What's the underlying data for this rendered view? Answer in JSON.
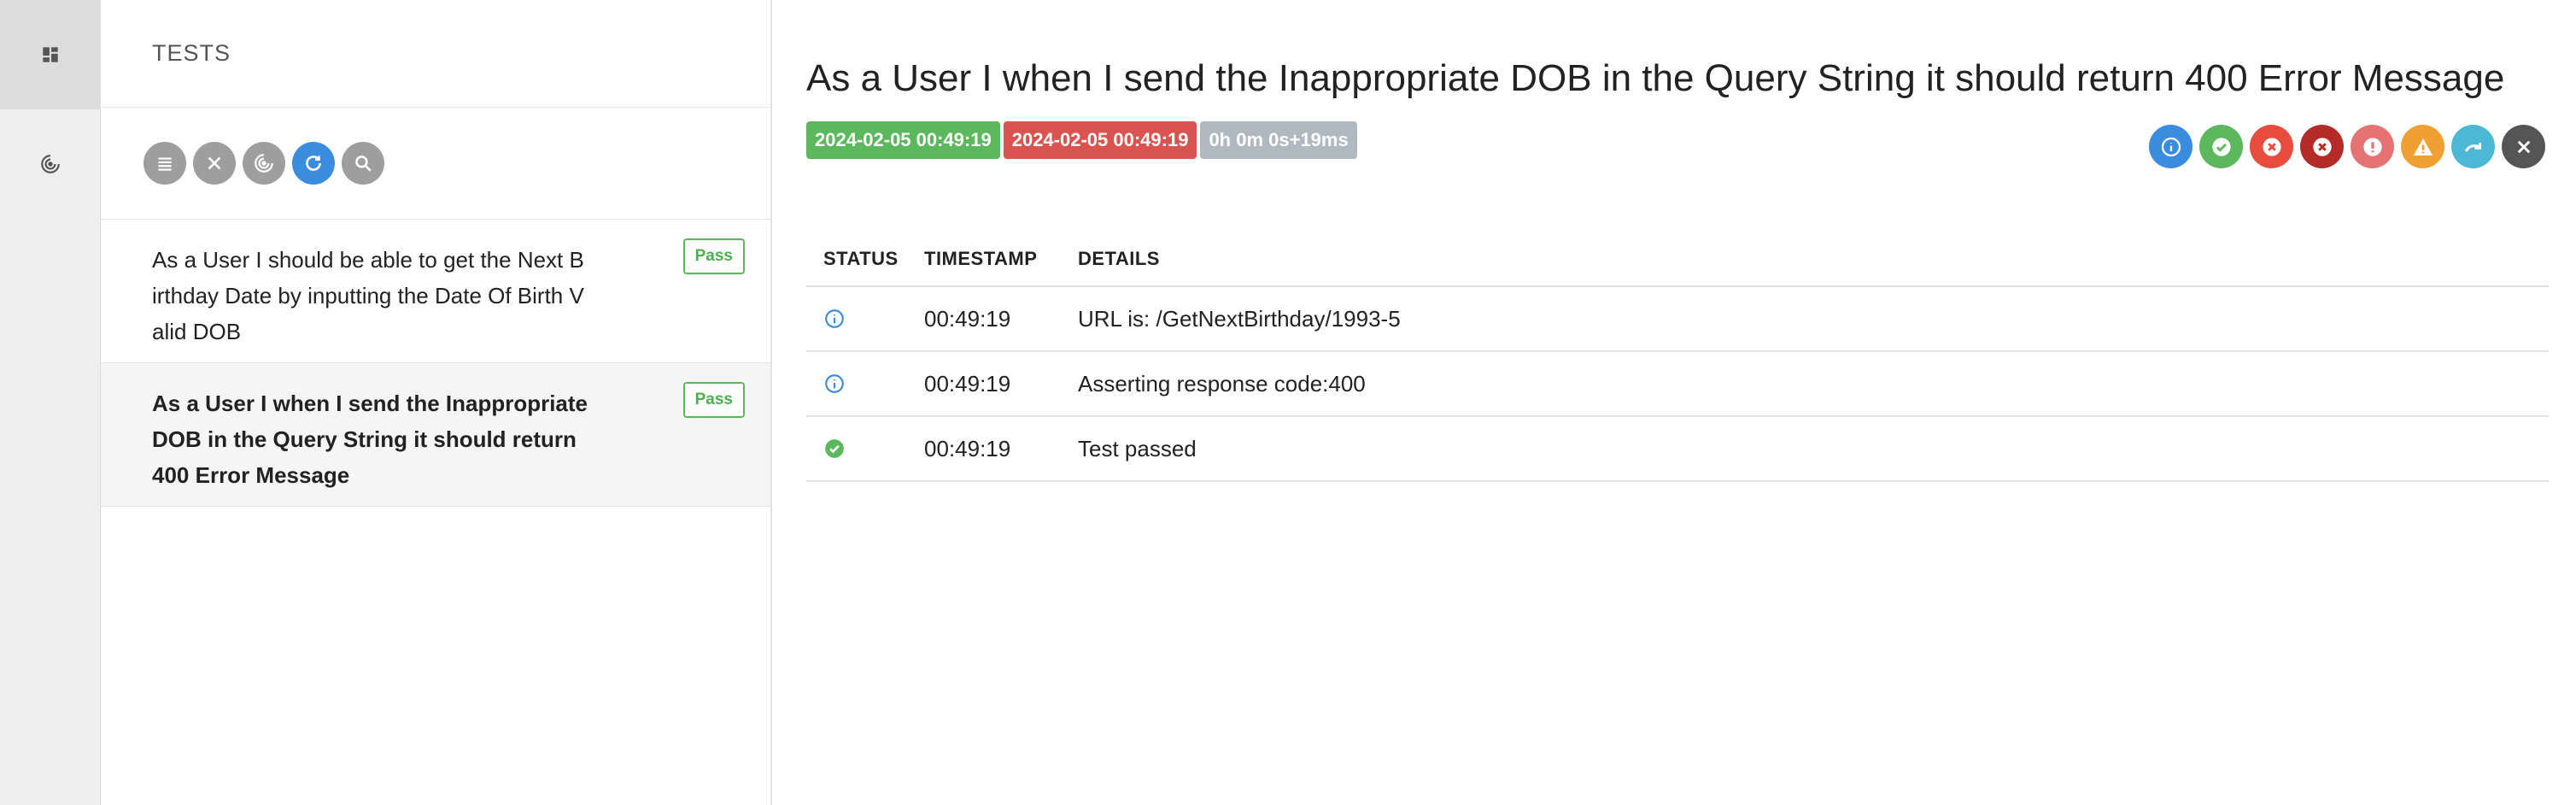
{
  "sidebar": {
    "items": [
      {
        "icon": "dashboard-icon",
        "active": true
      },
      {
        "icon": "radar-icon",
        "active": false
      }
    ]
  },
  "list": {
    "header": "TESTS",
    "toolbar": [
      "menu-icon",
      "close-icon",
      "radar-icon",
      "refresh-icon",
      "search-icon"
    ],
    "tests": [
      {
        "name": "As a User I should be able to get the Next Birthday Date by inputting the Date Of Birth Valid DOB",
        "status": "Pass"
      },
      {
        "name": "As a User I when I send the Inappropriate DOB in the Query String it should return 400 Error Message",
        "status": "Pass"
      }
    ]
  },
  "detail": {
    "title": "As a User I when I send the Inappropriate DOB in the Query String it should return 400 Error Message",
    "start_time": "2024-02-05 00:49:19",
    "end_time": "2024-02-05 00:49:19",
    "duration": "0h 0m 0s+19ms",
    "filters": [
      {
        "name": "info-filter-icon",
        "color": "#3a8dde"
      },
      {
        "name": "pass-filter-icon",
        "color": "#5cb85c"
      },
      {
        "name": "fail-filter-icon",
        "color": "#e74c3c"
      },
      {
        "name": "fatal-filter-icon",
        "color": "#b52b27"
      },
      {
        "name": "error-filter-icon",
        "color": "#e57373"
      },
      {
        "name": "warning-filter-icon",
        "color": "#f0a030"
      },
      {
        "name": "skip-filter-icon",
        "color": "#4cb8d6"
      },
      {
        "name": "clear-filter-icon",
        "color": "#555555"
      }
    ],
    "table": {
      "headers": [
        "STATUS",
        "TIMESTAMP",
        "DETAILS"
      ],
      "rows": [
        {
          "status": "info",
          "timestamp": "00:49:19",
          "details": "URL is: /GetNextBirthday/1993-5"
        },
        {
          "status": "info",
          "timestamp": "00:49:19",
          "details": "Asserting response code:400"
        },
        {
          "status": "pass",
          "timestamp": "00:49:19",
          "details": "Test passed"
        }
      ]
    }
  },
  "colors": {
    "pass": "#5cb85c",
    "fail": "#d9534f",
    "info": "#3a8dde",
    "muted": "#b0b8c0"
  }
}
